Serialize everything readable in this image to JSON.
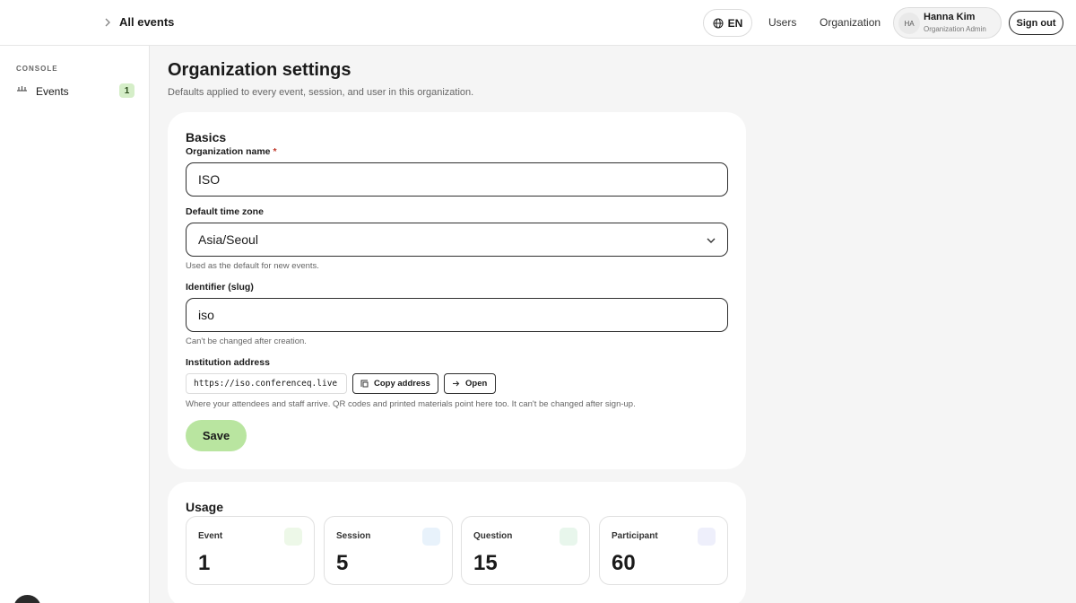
{
  "header": {
    "title": "All events",
    "language": "EN",
    "nav": [
      "Users",
      "Organization"
    ],
    "user": {
      "initials": "HA",
      "name": "Hanna Kim",
      "role": "Organization Admin"
    },
    "sign_out": "Sign out"
  },
  "sidebar": {
    "section": "CONSOLE",
    "items": [
      {
        "label": "Events",
        "badge": "1"
      }
    ]
  },
  "page": {
    "title": "Organization settings",
    "subtitle": "Defaults applied to every event, session, and user in this organization."
  },
  "basics": {
    "title": "Basics",
    "org_name_label": "Organization name",
    "required_mark": "*",
    "org_name_value": "ISO",
    "timezone_label": "Default time zone",
    "timezone_value": "Asia/Seoul",
    "timezone_hint": "Used as the default for new events.",
    "slug_label": "Identifier (slug)",
    "slug_value": "iso",
    "slug_hint": "Can't be changed after creation.",
    "address_label": "Institution address",
    "address_value": "https://iso.conferenceq.live",
    "copy_label": "Copy address",
    "open_label": "Open",
    "address_hint": "Where your attendees and staff arrive. QR codes and printed materials point here too. It can't be changed after sign-up.",
    "save_label": "Save"
  },
  "usage": {
    "title": "Usage",
    "stats": [
      {
        "label": "Event",
        "value": "1",
        "color": "#edf8e8"
      },
      {
        "label": "Session",
        "value": "5",
        "color": "#e8f2fb"
      },
      {
        "label": "Question",
        "value": "15",
        "color": "#e8f6ec"
      },
      {
        "label": "Participant",
        "value": "60",
        "color": "#eeeffb"
      }
    ]
  },
  "colors": {
    "accent": "#b9e5a0",
    "badge": "#d5eec8",
    "border": "#2f2f2f"
  }
}
